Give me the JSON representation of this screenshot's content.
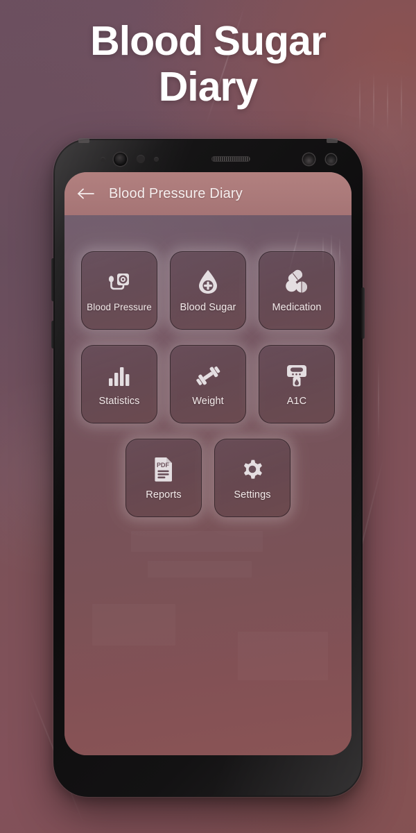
{
  "page": {
    "title_lines": [
      "Blood Sugar",
      "Diary"
    ],
    "bg_color_left": "#6d5060",
    "bg_color_right": "#7e4f53"
  },
  "phone": {
    "frame_color": "#0d0c0d",
    "sensors": [
      "proximity-sensor",
      "front-camera",
      "iris-sensor",
      "led-indicator",
      "earpiece-speaker",
      "ir-sensor",
      "light-sensor"
    ],
    "buttons": [
      "volume-button",
      "bixby-button",
      "power-button"
    ]
  },
  "appbar": {
    "back_icon": "arrow-left-icon",
    "title": "Blood Pressure Diary",
    "bg_color": "#ab7a7a",
    "text_color": "#f6eeee"
  },
  "grid": {
    "rows": [
      [
        {
          "label": "Blood Pressure",
          "icon": "blood-pressure-monitor-icon",
          "name": "blood-pressure"
        },
        {
          "label": "Blood Sugar",
          "icon": "blood-drop-plus-icon",
          "name": "blood-sugar"
        },
        {
          "label": "Medication",
          "icon": "pills-icon",
          "name": "medication"
        }
      ],
      [
        {
          "label": "Statistics",
          "icon": "bar-chart-icon",
          "name": "statistics"
        },
        {
          "label": "Weight",
          "icon": "dumbbell-icon",
          "name": "weight"
        },
        {
          "label": "A1C",
          "icon": "glucose-meter-icon",
          "name": "a1c"
        }
      ],
      [
        {
          "label": "Reports",
          "icon": "pdf-document-icon",
          "name": "reports"
        },
        {
          "label": "Settings",
          "icon": "gear-icon",
          "name": "settings"
        }
      ]
    ],
    "tile_bg": "#604854",
    "tile_glow": "#ffffff",
    "icon_color": "#e3dde0",
    "label_color": "#f2e9e9"
  }
}
